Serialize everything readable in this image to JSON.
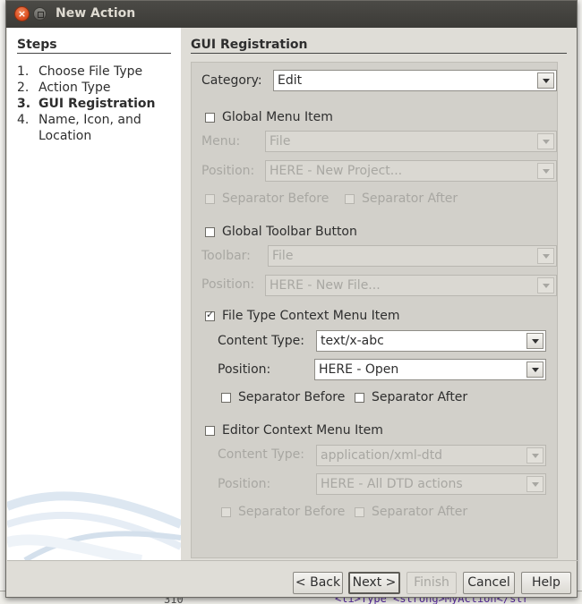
{
  "window": {
    "title": "New Action"
  },
  "steps": {
    "title": "Steps",
    "items": [
      {
        "num": "1.",
        "label": "Choose File Type"
      },
      {
        "num": "2.",
        "label": "Action Type"
      },
      {
        "num": "3.",
        "label": "GUI Registration"
      },
      {
        "num": "4.",
        "label": "Name, Icon, and Location"
      }
    ],
    "current_index": 3
  },
  "panel": {
    "title": "GUI Registration",
    "category": {
      "label": "Category:",
      "value": "Edit"
    },
    "global_menu": {
      "checkbox": "Global Menu Item",
      "checked": false,
      "menu_label": "Menu:",
      "menu_value": "File",
      "position_label": "Position:",
      "position_value": "HERE - New Project...",
      "sep_before": "Separator Before",
      "sep_after": "Separator After"
    },
    "global_toolbar": {
      "checkbox": "Global Toolbar Button",
      "checked": false,
      "toolbar_label": "Toolbar:",
      "toolbar_value": "File",
      "position_label": "Position:",
      "position_value": "HERE - New File..."
    },
    "file_type_context": {
      "checkbox": "File Type Context Menu Item",
      "checked": true,
      "content_type_label": "Content Type:",
      "content_type_value": "text/x-abc",
      "position_label": "Position:",
      "position_value": "HERE - Open",
      "sep_before": "Separator Before",
      "sep_after": "Separator After"
    },
    "editor_context": {
      "checkbox": "Editor Context Menu Item",
      "checked": false,
      "content_type_label": "Content Type:",
      "content_type_value": "application/xml-dtd",
      "position_label": "Position:",
      "position_value": "HERE - All DTD actions",
      "sep_before": "Separator Before",
      "sep_after": "Separator After"
    }
  },
  "buttons": {
    "back": "< Back",
    "next": "Next >",
    "finish": "Finish",
    "cancel": "Cancel",
    "help": "Help"
  },
  "background": {
    "line_number": "310",
    "code": "<li>Type <strong>MyAction</str"
  }
}
